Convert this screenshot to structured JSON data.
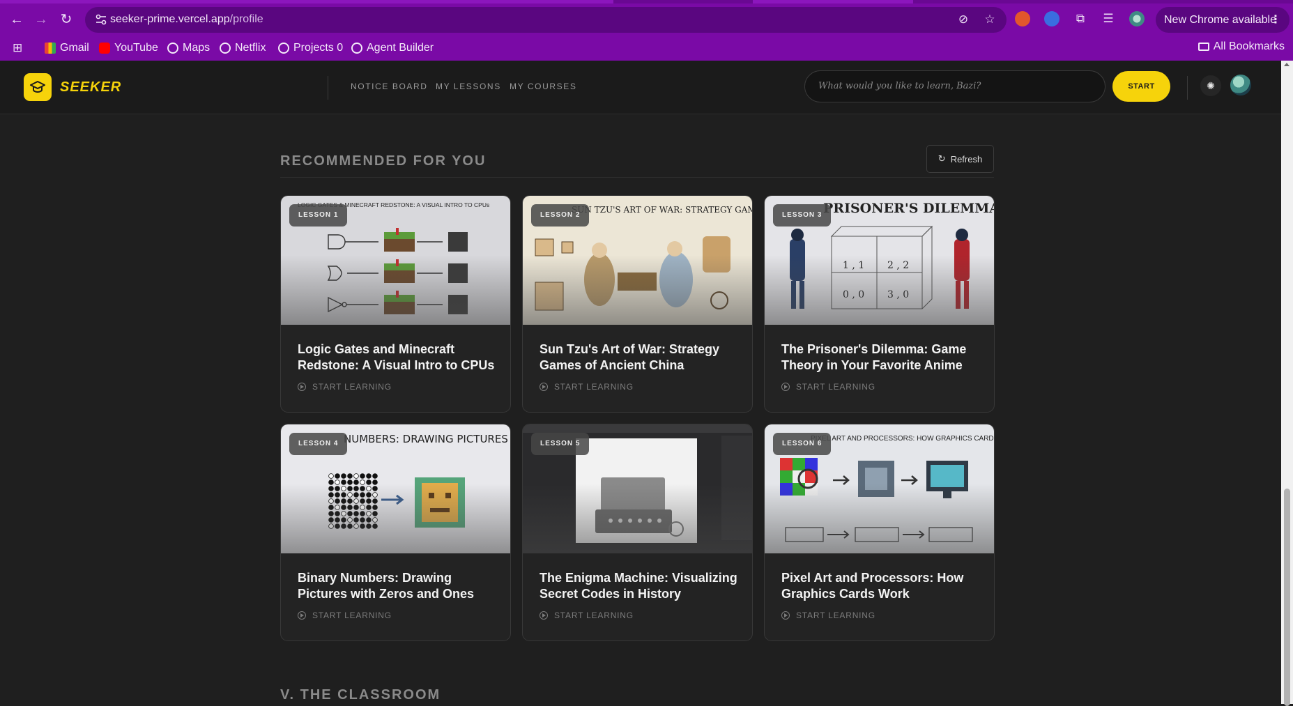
{
  "browser": {
    "url_host": "seeker-prime.vercel.app",
    "url_path": "/profile",
    "update_label": "New Chrome available",
    "bookmarks": [
      {
        "label": "Gmail"
      },
      {
        "label": "YouTube"
      },
      {
        "label": "Maps"
      },
      {
        "label": "Netflix"
      },
      {
        "label": "Projects 0"
      },
      {
        "label": "Agent Builder"
      }
    ],
    "all_bookmarks_label": "All Bookmarks",
    "accent_color": "#7a0aa6"
  },
  "app": {
    "logo_text": "SEEKER",
    "brand_color": "#f6d30b",
    "nav": [
      "NOTICE BOARD",
      "MY LESSONS",
      "MY COURSES"
    ],
    "search_placeholder": "What would you like to learn, Bazi?",
    "start_label": "START"
  },
  "recommended": {
    "title": "RECOMMENDED FOR YOU",
    "refresh_label": "Refresh",
    "cta_label": "START LEARNING",
    "cards": [
      {
        "badge": "LESSON 1",
        "title": "Logic Gates and Minecraft Redstone: A Visual Intro to CPUs",
        "thumb_caption": "LOGIC GATES & MINECRAFT REDSTONE: A VISUAL INTRO TO CPUs"
      },
      {
        "badge": "LESSON 2",
        "title": "Sun Tzu's Art of War: Strategy Games of Ancient China",
        "thumb_caption": "SUN TZU'S ART OF WAR: STRATEGY GAMES OF ANCIENT CHINA"
      },
      {
        "badge": "LESSON 3",
        "title": "The Prisoner's Dilemma: Game Theory in Your Favorite Anime",
        "thumb_caption": "PRISONER'S DILEMMA"
      },
      {
        "badge": "LESSON 4",
        "title": "Binary Numbers: Drawing Pictures with Zeros and Ones",
        "thumb_caption": "NUMBERS: DRAWING PICTURES WITH ZEROS AND ONES"
      },
      {
        "badge": "LESSON 5",
        "title": "The Enigma Machine: Visualizing Secret Codes in History",
        "thumb_caption": ""
      },
      {
        "badge": "LESSON 6",
        "title": "Pixel Art and Processors: How Graphics Cards Work",
        "thumb_caption": "PIXEL ART AND PROCESSORS: HOW GRAPHICS CARDS WORK"
      }
    ]
  },
  "classroom": {
    "title": "V. THE CLASSROOM"
  }
}
